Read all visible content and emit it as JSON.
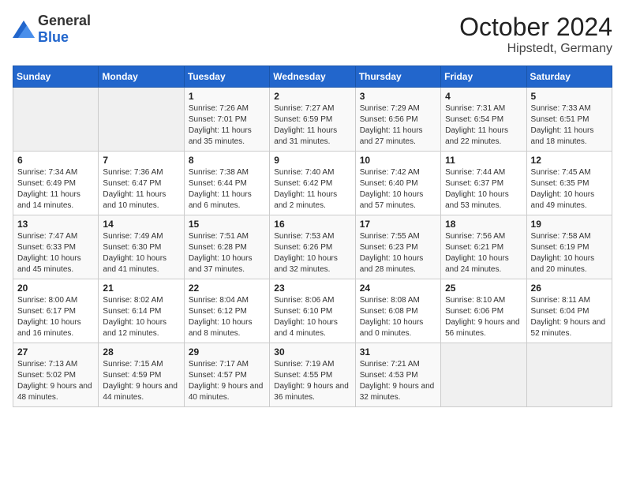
{
  "logo": {
    "general": "General",
    "blue": "Blue"
  },
  "header": {
    "month": "October 2024",
    "location": "Hipstedt, Germany"
  },
  "days_of_week": [
    "Sunday",
    "Monday",
    "Tuesday",
    "Wednesday",
    "Thursday",
    "Friday",
    "Saturday"
  ],
  "weeks": [
    [
      {
        "day": "",
        "details": ""
      },
      {
        "day": "",
        "details": ""
      },
      {
        "day": "1",
        "details": "Sunrise: 7:26 AM\nSunset: 7:01 PM\nDaylight: 11 hours and 35 minutes."
      },
      {
        "day": "2",
        "details": "Sunrise: 7:27 AM\nSunset: 6:59 PM\nDaylight: 11 hours and 31 minutes."
      },
      {
        "day": "3",
        "details": "Sunrise: 7:29 AM\nSunset: 6:56 PM\nDaylight: 11 hours and 27 minutes."
      },
      {
        "day": "4",
        "details": "Sunrise: 7:31 AM\nSunset: 6:54 PM\nDaylight: 11 hours and 22 minutes."
      },
      {
        "day": "5",
        "details": "Sunrise: 7:33 AM\nSunset: 6:51 PM\nDaylight: 11 hours and 18 minutes."
      }
    ],
    [
      {
        "day": "6",
        "details": "Sunrise: 7:34 AM\nSunset: 6:49 PM\nDaylight: 11 hours and 14 minutes."
      },
      {
        "day": "7",
        "details": "Sunrise: 7:36 AM\nSunset: 6:47 PM\nDaylight: 11 hours and 10 minutes."
      },
      {
        "day": "8",
        "details": "Sunrise: 7:38 AM\nSunset: 6:44 PM\nDaylight: 11 hours and 6 minutes."
      },
      {
        "day": "9",
        "details": "Sunrise: 7:40 AM\nSunset: 6:42 PM\nDaylight: 11 hours and 2 minutes."
      },
      {
        "day": "10",
        "details": "Sunrise: 7:42 AM\nSunset: 6:40 PM\nDaylight: 10 hours and 57 minutes."
      },
      {
        "day": "11",
        "details": "Sunrise: 7:44 AM\nSunset: 6:37 PM\nDaylight: 10 hours and 53 minutes."
      },
      {
        "day": "12",
        "details": "Sunrise: 7:45 AM\nSunset: 6:35 PM\nDaylight: 10 hours and 49 minutes."
      }
    ],
    [
      {
        "day": "13",
        "details": "Sunrise: 7:47 AM\nSunset: 6:33 PM\nDaylight: 10 hours and 45 minutes."
      },
      {
        "day": "14",
        "details": "Sunrise: 7:49 AM\nSunset: 6:30 PM\nDaylight: 10 hours and 41 minutes."
      },
      {
        "day": "15",
        "details": "Sunrise: 7:51 AM\nSunset: 6:28 PM\nDaylight: 10 hours and 37 minutes."
      },
      {
        "day": "16",
        "details": "Sunrise: 7:53 AM\nSunset: 6:26 PM\nDaylight: 10 hours and 32 minutes."
      },
      {
        "day": "17",
        "details": "Sunrise: 7:55 AM\nSunset: 6:23 PM\nDaylight: 10 hours and 28 minutes."
      },
      {
        "day": "18",
        "details": "Sunrise: 7:56 AM\nSunset: 6:21 PM\nDaylight: 10 hours and 24 minutes."
      },
      {
        "day": "19",
        "details": "Sunrise: 7:58 AM\nSunset: 6:19 PM\nDaylight: 10 hours and 20 minutes."
      }
    ],
    [
      {
        "day": "20",
        "details": "Sunrise: 8:00 AM\nSunset: 6:17 PM\nDaylight: 10 hours and 16 minutes."
      },
      {
        "day": "21",
        "details": "Sunrise: 8:02 AM\nSunset: 6:14 PM\nDaylight: 10 hours and 12 minutes."
      },
      {
        "day": "22",
        "details": "Sunrise: 8:04 AM\nSunset: 6:12 PM\nDaylight: 10 hours and 8 minutes."
      },
      {
        "day": "23",
        "details": "Sunrise: 8:06 AM\nSunset: 6:10 PM\nDaylight: 10 hours and 4 minutes."
      },
      {
        "day": "24",
        "details": "Sunrise: 8:08 AM\nSunset: 6:08 PM\nDaylight: 10 hours and 0 minutes."
      },
      {
        "day": "25",
        "details": "Sunrise: 8:10 AM\nSunset: 6:06 PM\nDaylight: 9 hours and 56 minutes."
      },
      {
        "day": "26",
        "details": "Sunrise: 8:11 AM\nSunset: 6:04 PM\nDaylight: 9 hours and 52 minutes."
      }
    ],
    [
      {
        "day": "27",
        "details": "Sunrise: 7:13 AM\nSunset: 5:02 PM\nDaylight: 9 hours and 48 minutes."
      },
      {
        "day": "28",
        "details": "Sunrise: 7:15 AM\nSunset: 4:59 PM\nDaylight: 9 hours and 44 minutes."
      },
      {
        "day": "29",
        "details": "Sunrise: 7:17 AM\nSunset: 4:57 PM\nDaylight: 9 hours and 40 minutes."
      },
      {
        "day": "30",
        "details": "Sunrise: 7:19 AM\nSunset: 4:55 PM\nDaylight: 9 hours and 36 minutes."
      },
      {
        "day": "31",
        "details": "Sunrise: 7:21 AM\nSunset: 4:53 PM\nDaylight: 9 hours and 32 minutes."
      },
      {
        "day": "",
        "details": ""
      },
      {
        "day": "",
        "details": ""
      }
    ]
  ]
}
